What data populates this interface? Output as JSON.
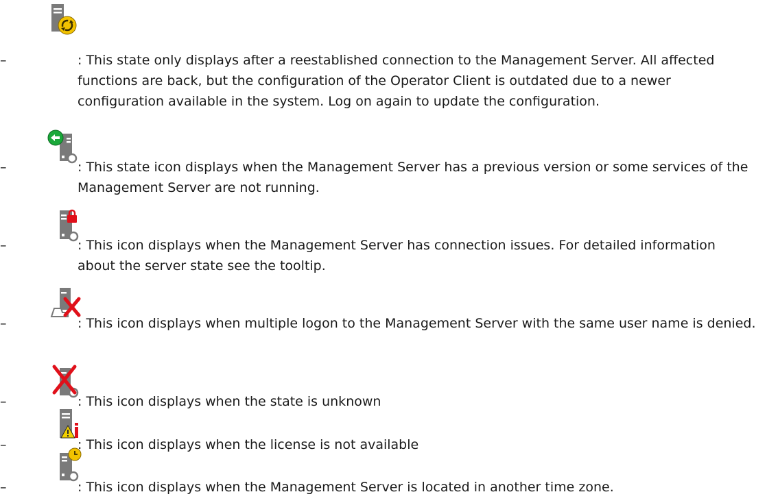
{
  "list_marker": "–",
  "items": [
    {
      "icon": "server-sync-outdated-config-icon",
      "text": ": This state only displays after a reestablished connection to the Management Server. All affected functions are back, but the configuration of the Operator Client is outdated due to a newer configuration available in the system. Log on again to update the configuration."
    },
    {
      "icon": "server-previous-version-icon",
      "text": ": This state icon displays when the Management Server has a previous version or some services of the Management Server are not running."
    },
    {
      "icon": "server-connection-issues-icon",
      "text": ": This icon displays when the Management Server has connection issues. For detailed information about the server state see the tooltip."
    },
    {
      "icon": "server-multiple-logon-denied-icon",
      "text": ": This icon displays when multiple logon to the Management Server with the same user name is denied."
    },
    {
      "icon": "server-state-unknown-icon",
      "text": ": This icon displays when the state is unknown"
    },
    {
      "icon": "server-license-unavailable-icon",
      "text": ": This icon displays when the license is not available"
    },
    {
      "icon": "server-other-time-zone-icon",
      "text": ": This icon displays when the Management Server is located in another time zone."
    }
  ]
}
